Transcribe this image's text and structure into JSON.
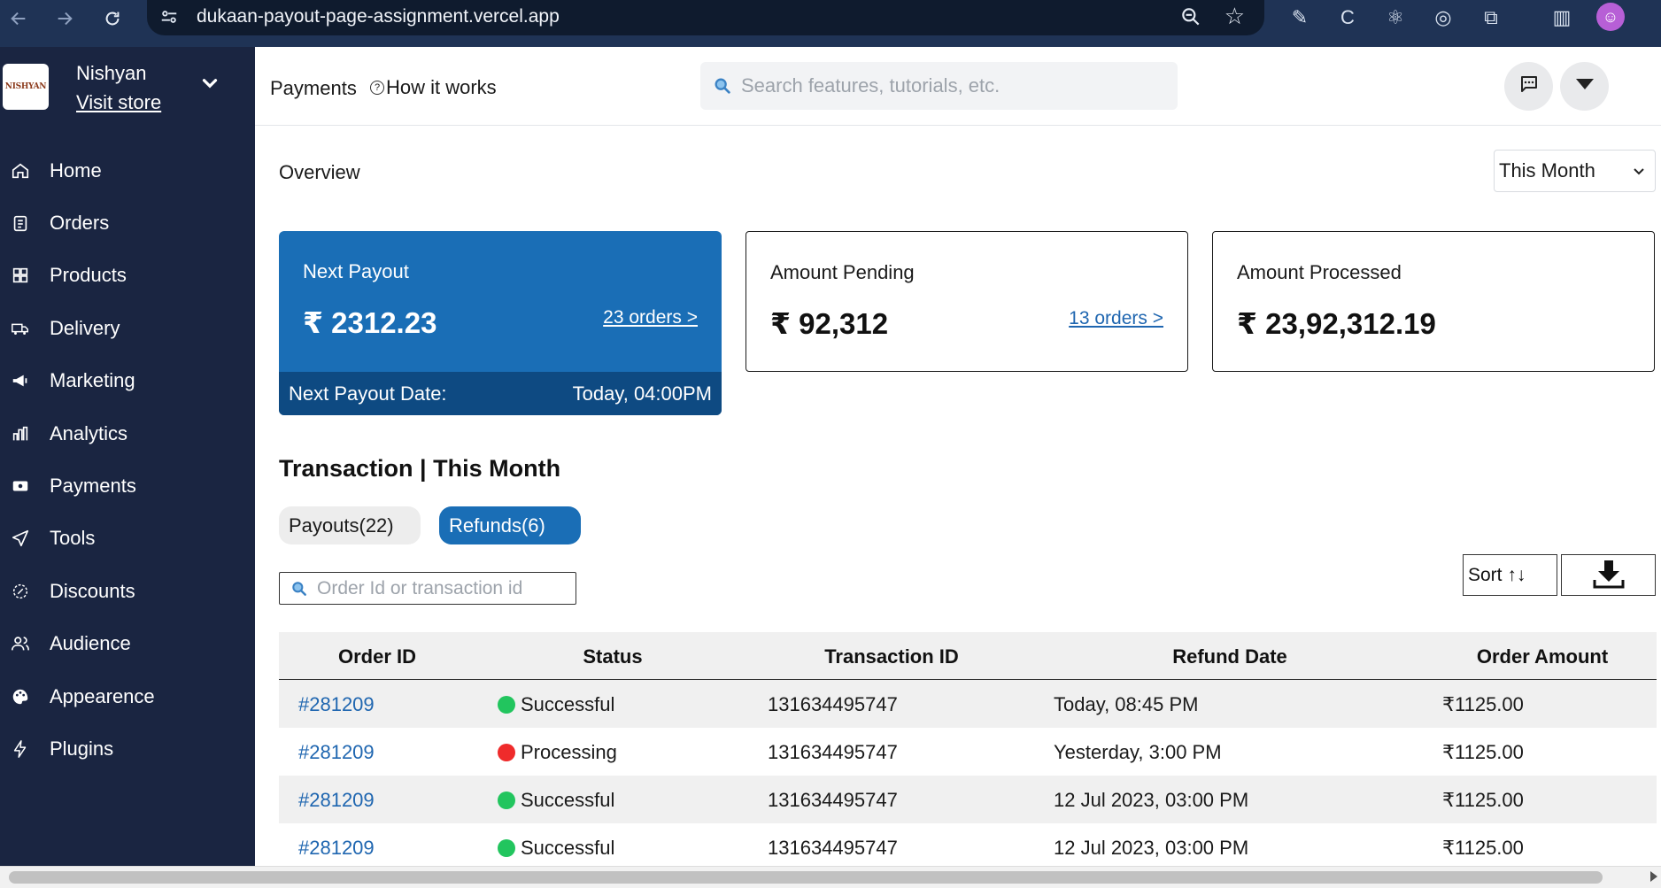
{
  "browser": {
    "url": "dukaan-payout-page-assignment.vercel.app"
  },
  "sidebar": {
    "store_logo_text": "NISHYAN",
    "store_name": "Nishyan",
    "visit_store": "Visit store",
    "items": [
      {
        "label": "Home",
        "icon": "home-icon"
      },
      {
        "label": "Orders",
        "icon": "clipboard-icon"
      },
      {
        "label": "Products",
        "icon": "grid-icon"
      },
      {
        "label": "Delivery",
        "icon": "truck-icon"
      },
      {
        "label": "Marketing",
        "icon": "megaphone-icon"
      },
      {
        "label": "Analytics",
        "icon": "bar-chart-icon"
      },
      {
        "label": "Payments",
        "icon": "wallet-icon"
      },
      {
        "label": "Tools",
        "icon": "send-icon"
      },
      {
        "label": "Discounts",
        "icon": "badge-icon"
      },
      {
        "label": "Audience",
        "icon": "users-icon"
      },
      {
        "label": "Appearence",
        "icon": "palette-icon"
      },
      {
        "label": "Plugins",
        "icon": "bolt-icon"
      }
    ]
  },
  "header": {
    "title": "Payments",
    "how_it_works": "How it works",
    "search_placeholder": "Search features, tutorials, etc."
  },
  "overview": {
    "title": "Overview",
    "period": "This Month"
  },
  "cards": {
    "next_payout": {
      "label": "Next Payout",
      "amount": "₹ 2312.23",
      "link": "23 orders >",
      "footer_label": "Next Payout Date:",
      "footer_value": "Today, 04:00PM"
    },
    "pending": {
      "label": "Amount Pending",
      "amount": "₹ 92,312",
      "link": "13 orders >"
    },
    "processed": {
      "label": "Amount Processed",
      "amount": "₹ 23,92,312.19"
    }
  },
  "transactions": {
    "title": "Transaction | This Month",
    "tabs": [
      {
        "label": "Payouts(22)",
        "active": false
      },
      {
        "label": "Refunds(6)",
        "active": true
      }
    ],
    "search_placeholder": "Order Id or transaction id",
    "sort_label": "Sort ↑↓",
    "columns": [
      "Order ID",
      "Status",
      "Transaction ID",
      "Refund Date",
      "Order Amount"
    ],
    "rows": [
      {
        "order_id": "#281209",
        "status": "Successful",
        "status_color": "#22c55e",
        "transaction_id": "131634495747",
        "refund_date": "Today, 08:45 PM",
        "amount": "₹1125.00"
      },
      {
        "order_id": "#281209",
        "status": "Processing",
        "status_color": "#ef2b2b",
        "transaction_id": "131634495747",
        "refund_date": "Yesterday, 3:00 PM",
        "amount": "₹1125.00"
      },
      {
        "order_id": "#281209",
        "status": "Successful",
        "status_color": "#22c55e",
        "transaction_id": "131634495747",
        "refund_date": "12 Jul 2023, 03:00 PM",
        "amount": "₹1125.00"
      },
      {
        "order_id": "#281209",
        "status": "Successful",
        "status_color": "#22c55e",
        "transaction_id": "131634495747",
        "refund_date": "12 Jul 2023, 03:00 PM",
        "amount": "₹1125.00"
      }
    ]
  },
  "colors": {
    "sidebar_bg": "#1a2541",
    "primary": "#1a6eb6",
    "primary_dark": "#0e4a82",
    "link": "#1f66b0"
  }
}
